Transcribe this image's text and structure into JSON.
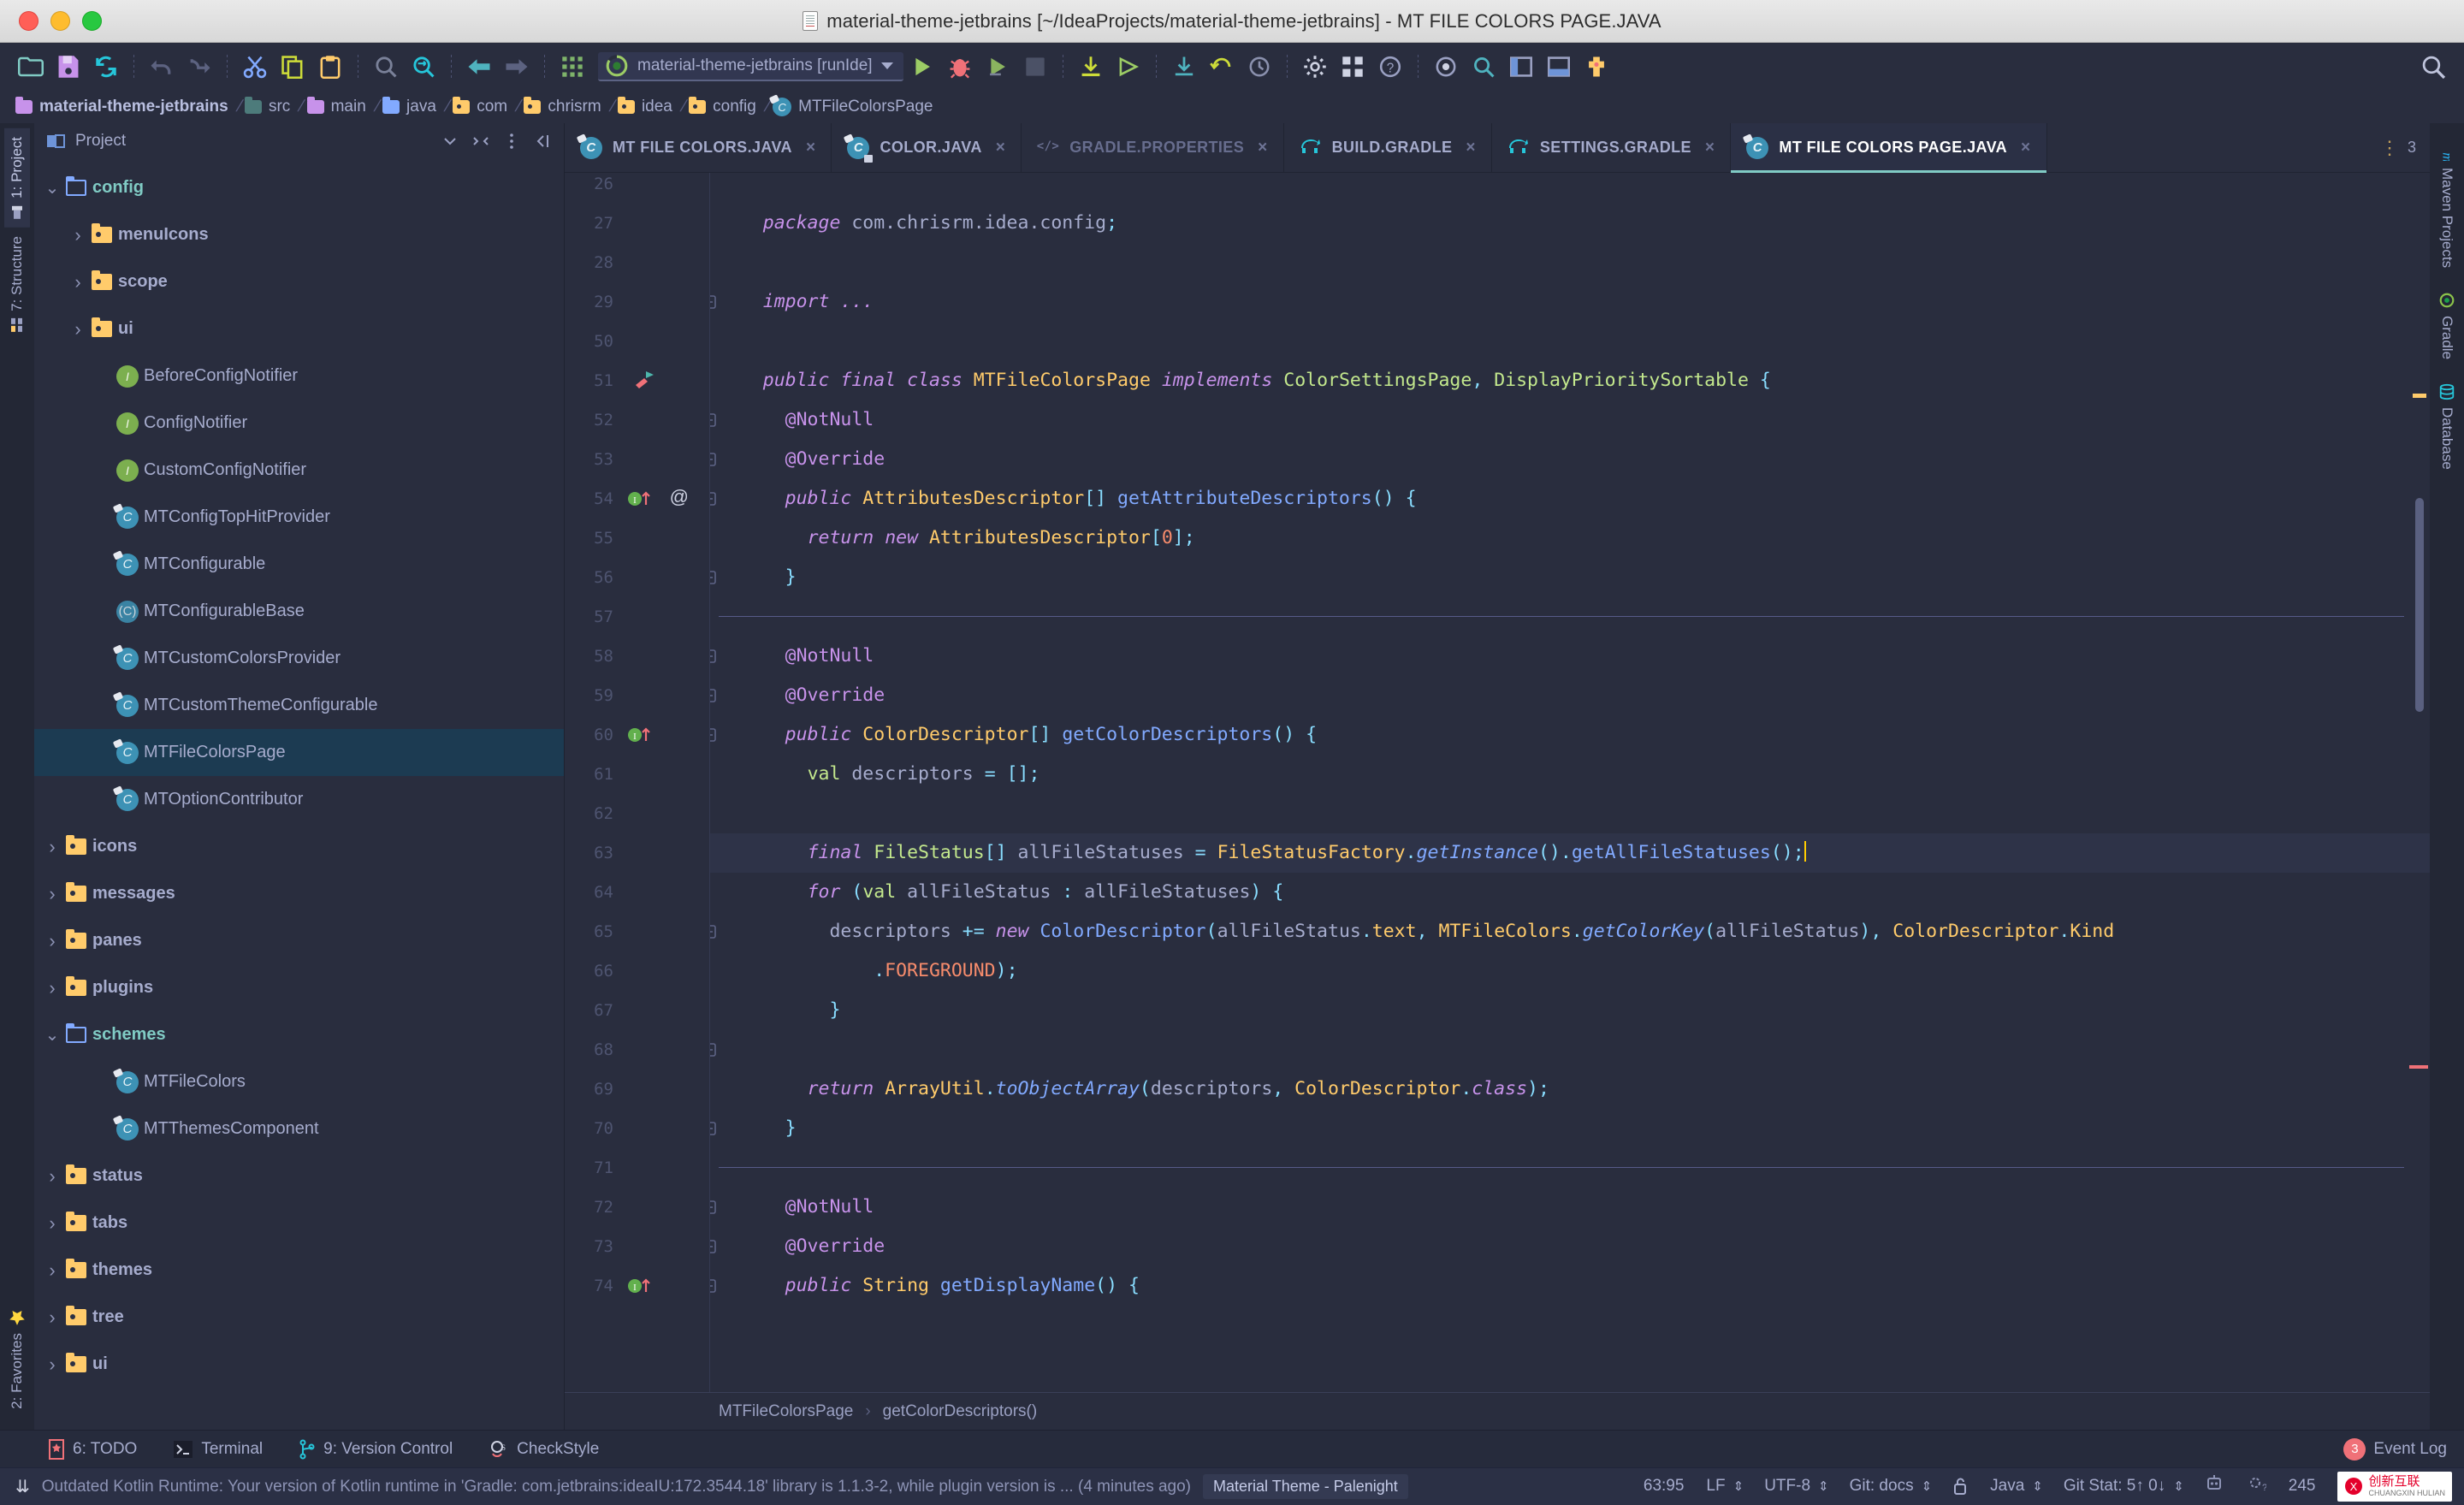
{
  "window": {
    "title": "material-theme-jetbrains [~/IdeaProjects/material-theme-jetbrains] - MT FILE COLORS PAGE.JAVA"
  },
  "toolbar": {
    "icons": [
      "open-folder-icon",
      "save-icon",
      "sync-icon",
      "undo-icon",
      "redo-icon",
      "cut-icon",
      "copy-icon",
      "paste-icon",
      "find-icon",
      "replace-icon",
      "back-icon",
      "forward-icon",
      "grid-icon"
    ],
    "run_config": "material-theme-jetbrains [runIde]",
    "right_icons": [
      "run-icon",
      "debug-icon",
      "run-coverage-icon",
      "stop-icon",
      "build-icon",
      "run-anything-icon",
      "update-icon",
      "rollback-icon",
      "history-icon",
      "settings-icon",
      "modules-icon",
      "help-icon",
      "preferences-icon",
      "search-everywhere-icon",
      "layout-icon",
      "layout2-icon",
      "plugin-icon"
    ],
    "search_icon": "magnifier-icon"
  },
  "breadcrumbs": [
    {
      "label": "material-theme-jetbrains",
      "icon": "module-folder-icon",
      "bold": true
    },
    {
      "label": "src",
      "icon": "source-folder-icon",
      "bold": false
    },
    {
      "label": "main",
      "icon": "module-folder-icon",
      "bold": false
    },
    {
      "label": "java",
      "icon": "java-source-folder-icon",
      "bold": false
    },
    {
      "label": "com",
      "icon": "package-icon",
      "bold": false
    },
    {
      "label": "chrisrm",
      "icon": "package-icon",
      "bold": false
    },
    {
      "label": "idea",
      "icon": "package-icon",
      "bold": false
    },
    {
      "label": "config",
      "icon": "package-icon",
      "bold": false
    },
    {
      "label": "MTFileColorsPage",
      "icon": "class-icon",
      "bold": false
    }
  ],
  "left_rail": [
    {
      "label": "1: Project",
      "icon": "project-icon",
      "active": true
    },
    {
      "label": "7: Structure",
      "icon": "structure-icon",
      "active": false
    },
    {
      "label": "2: Favorites",
      "icon": "star-icon",
      "active": false
    }
  ],
  "right_rail": [
    {
      "label": "Maven Projects",
      "icon": "maven-icon"
    },
    {
      "label": "Gradle",
      "icon": "gradle-icon"
    },
    {
      "label": "Database",
      "icon": "database-icon"
    }
  ],
  "project_panel": {
    "title": "Project",
    "header_icons": [
      "collapse-all-icon",
      "options-menu-icon",
      "hide-panel-icon"
    ],
    "selector_caret": "chevron-down-icon",
    "tree": [
      {
        "label": "config",
        "type": "package-open",
        "depth": 1,
        "twist": "down",
        "selected": false
      },
      {
        "label": "menuIcons",
        "type": "folder",
        "depth": 2,
        "twist": "right",
        "selected": false
      },
      {
        "label": "scope",
        "type": "folder",
        "depth": 2,
        "twist": "right",
        "selected": false
      },
      {
        "label": "ui",
        "type": "folder",
        "depth": 2,
        "twist": "right",
        "selected": false
      },
      {
        "label": "BeforeConfigNotifier",
        "type": "interface",
        "depth": 3,
        "twist": "",
        "selected": false
      },
      {
        "label": "ConfigNotifier",
        "type": "interface",
        "depth": 3,
        "twist": "",
        "selected": false
      },
      {
        "label": "CustomConfigNotifier",
        "type": "interface",
        "depth": 3,
        "twist": "",
        "selected": false
      },
      {
        "label": "MTConfigTopHitProvider",
        "type": "class",
        "depth": 3,
        "twist": "",
        "selected": false
      },
      {
        "label": "MTConfigurable",
        "type": "class",
        "depth": 3,
        "twist": "",
        "selected": false
      },
      {
        "label": "MTConfigurableBase",
        "type": "abstract",
        "depth": 3,
        "twist": "",
        "selected": false
      },
      {
        "label": "MTCustomColorsProvider",
        "type": "class",
        "depth": 3,
        "twist": "",
        "selected": false
      },
      {
        "label": "MTCustomThemeConfigurable",
        "type": "class",
        "depth": 3,
        "twist": "",
        "selected": false
      },
      {
        "label": "MTFileColorsPage",
        "type": "class",
        "depth": 3,
        "twist": "",
        "selected": true
      },
      {
        "label": "MTOptionContributor",
        "type": "class",
        "depth": 3,
        "twist": "",
        "selected": false
      },
      {
        "label": "icons",
        "type": "folder",
        "depth": 1,
        "twist": "right",
        "selected": false
      },
      {
        "label": "messages",
        "type": "folder",
        "depth": 1,
        "twist": "right",
        "selected": false
      },
      {
        "label": "panes",
        "type": "folder",
        "depth": 1,
        "twist": "right",
        "selected": false
      },
      {
        "label": "plugins",
        "type": "folder",
        "depth": 1,
        "twist": "right",
        "selected": false
      },
      {
        "label": "schemes",
        "type": "package-open",
        "depth": 1,
        "twist": "down",
        "selected": false
      },
      {
        "label": "MTFileColors",
        "type": "class",
        "depth": 3,
        "twist": "",
        "selected": false
      },
      {
        "label": "MTThemesComponent",
        "type": "class",
        "depth": 3,
        "twist": "",
        "selected": false
      },
      {
        "label": "status",
        "type": "folder",
        "depth": 1,
        "twist": "right",
        "selected": false
      },
      {
        "label": "tabs",
        "type": "folder",
        "depth": 1,
        "twist": "right",
        "selected": false
      },
      {
        "label": "themes",
        "type": "folder",
        "depth": 1,
        "twist": "right",
        "selected": false
      },
      {
        "label": "tree",
        "type": "folder",
        "depth": 1,
        "twist": "right",
        "selected": false
      },
      {
        "label": "ui",
        "type": "folder",
        "depth": 1,
        "twist": "right",
        "selected": false
      }
    ]
  },
  "editor_tabs": [
    {
      "label": "MT FILE COLORS.JAVA",
      "icon": "java-class-icon",
      "active": false,
      "muted": false,
      "close": "×"
    },
    {
      "label": "COLOR.JAVA",
      "icon": "java-final-icon",
      "active": false,
      "muted": false,
      "close": "×"
    },
    {
      "label": "GRADLE.PROPERTIES",
      "icon": "properties-icon",
      "active": false,
      "muted": true,
      "close": "×"
    },
    {
      "label": "BUILD.GRADLE",
      "icon": "gradle-file-icon",
      "active": false,
      "muted": false,
      "close": "×"
    },
    {
      "label": "SETTINGS.GRADLE",
      "icon": "gradle-file-icon",
      "active": false,
      "muted": false,
      "close": "×"
    },
    {
      "label": "MT FILE COLORS PAGE.JAVA",
      "icon": "java-class-icon",
      "active": true,
      "muted": false,
      "close": "×"
    }
  ],
  "editor_tabs_right": {
    "more_icon": "vertical-dots-icon",
    "count": "3"
  },
  "code": {
    "first_line": 26,
    "lines": [
      {
        "n": 26,
        "html": ""
      },
      {
        "n": 27,
        "html": "    <span class='kw'>package</span> <span class='id'>com.chrisrm.idea.config</span><span class='pun'>;</span>"
      },
      {
        "n": 28,
        "html": ""
      },
      {
        "n": 29,
        "html": "    <span class='kw'>import</span> <span class='kw'>...</span>",
        "fold": "+"
      },
      {
        "n": 30,
        "html": ""
      },
      {
        "n": 31,
        "html": "    <span class='kw'>public</span> <span class='kw'>final</span> <span class='kw'>class</span> <span class='typ'>MTFileColorsPage</span> <span class='kw'>implements</span> <span class='str'>ColorSettingsPage</span><span class='pun'>,</span> <span class='str'>DisplayPrioritySortable</span> <span class='pun'>{</span>",
        "gutter": "run-class-icon"
      },
      {
        "n": 32,
        "html": "      <span class='ann'>@NotNull</span>",
        "fold": "-"
      },
      {
        "n": 33,
        "html": "      <span class='ann'>@Override</span>",
        "fold": "-"
      },
      {
        "n": 34,
        "html": "      <span class='kw'>public</span> <span class='typ'>AttributesDescriptor</span><span class='pun'>[]</span> <span class='fn'>getAttributeDescriptors</span><span class='pun'>()</span> <span class='pun'>{</span>",
        "fold": "-",
        "gutter": "implements-icon",
        "gutter2": "@"
      },
      {
        "n": 35,
        "html": "        <span class='kw'>return</span> <span class='kw'>new</span> <span class='typ'>AttributesDescriptor</span><span class='pun'>[</span><span class='num'>0</span><span class='pun'>];</span>"
      },
      {
        "n": 36,
        "html": "      <span class='pun'>}</span>",
        "fold": "-"
      },
      {
        "n": 37,
        "html": "",
        "separator": true
      },
      {
        "n": 38,
        "html": "      <span class='ann'>@NotNull</span>",
        "fold": "-"
      },
      {
        "n": 39,
        "html": "      <span class='ann'>@Override</span>",
        "fold": "-"
      },
      {
        "n": 40,
        "html": "      <span class='kw'>public</span> <span class='typ'>ColorDescriptor</span><span class='pun'>[]</span> <span class='fn'>getColorDescriptors</span><span class='pun'>()</span> <span class='pun'>{</span>",
        "fold": "-",
        "gutter": "implements-icon"
      },
      {
        "n": 41,
        "html": "        <span class='str'>val</span> <span class='id'>descriptors</span> <span class='pun'>=</span> <span class='pun'>[];</span>"
      },
      {
        "n": 42,
        "html": ""
      },
      {
        "n": 43,
        "html": "        <span class='kw'>final</span> <span class='str'>FileStatus</span><span class='pun'>[]</span> <span class='id'>allFileStatuses</span> <span class='pun'>=</span> <span class='typ'>FileStatusFactory</span><span class='pun'>.</span><span class='fni'>getInstance</span><span class='pun'>().</span><span class='fn'>getAllFileStatuses</span><span class='pun'>();</span><span class='caret'></span>",
        "highlight": true
      },
      {
        "n": 44,
        "html": "        <span class='kw'>for</span> <span class='pun'>(</span><span class='str'>val</span> <span class='id'>allFileStatus</span> <span class='pun'>:</span> <span class='id'>allFileStatuses</span><span class='pun'>)</span> <span class='pun'>{</span>"
      },
      {
        "n": 45,
        "html": "          <span class='id'>descriptors</span> <span class='pun'>+=</span> <span class='kw'>new</span> <span class='fn'>ColorDescriptor</span><span class='pun'>(</span><span class='id'>allFileStatus</span><span class='pun'>.</span><span class='fld'>text</span><span class='pun'>,</span> <span class='typ'>MTFileColors</span><span class='pun'>.</span><span class='fni'>getColorKey</span><span class='pun'>(</span><span class='id'>allFileStatus</span><span class='pun'>),</span> <span class='typ'>ColorDescriptor</span><span class='pun'>.</span><span class='typ'>Kind</span>",
        "fold": "+"
      },
      {
        "n": 46,
        "html": "              <span class='pun'>.</span><span class='num'>FOREGROUND</span><span class='pun'>);</span>"
      },
      {
        "n": 47,
        "html": "          <span class='pun'>}</span>"
      },
      {
        "n": 48,
        "html": "",
        "fold": "-"
      },
      {
        "n": 49,
        "html": "        <span class='kw'>return</span> <span class='typ'>ArrayUtil</span><span class='pun'>.</span><span class='fni'>toObjectArray</span><span class='pun'>(</span><span class='id'>descriptors</span><span class='pun'>,</span> <span class='typ'>ColorDescriptor</span><span class='pun'>.</span><span class='kw'>class</span><span class='pun'>);</span>"
      },
      {
        "n": 50,
        "html": "      <span class='pun'>}</span>",
        "fold": "-"
      },
      {
        "n": 51,
        "html": "",
        "separator": true
      },
      {
        "n": 52,
        "html": "      <span class='ann'>@NotNull</span>",
        "fold": "-"
      },
      {
        "n": 53,
        "html": "      <span class='ann'>@Override</span>",
        "fold": "-"
      },
      {
        "n": 54,
        "html": "      <span class='kw'>public</span> <span class='typ'>String</span> <span class='fn'>getDisplayName</span><span class='pun'>()</span> <span class='pun'>{</span>",
        "fold": "-",
        "gutter": "implements-icon"
      }
    ],
    "line_numbers": [
      26,
      27,
      28,
      29,
      30,
      31,
      32,
      33,
      34,
      35,
      36,
      37,
      38,
      39,
      40,
      41,
      42,
      43,
      44,
      45,
      46,
      47,
      48,
      49,
      50,
      51,
      52,
      53,
      54
    ],
    "displayed_numbers": [
      "26",
      "27",
      "28",
      "29",
      "50",
      "51",
      "52",
      "53",
      "54",
      "55",
      "56",
      "57",
      "58",
      "59",
      "60",
      "61",
      "62",
      "63",
      "64",
      "65",
      "66",
      "67",
      "68",
      "69",
      "70",
      "71",
      "72",
      "73",
      "74"
    ]
  },
  "editor_breadcrumb": [
    "MTFileColorsPage",
    "getColorDescriptors()"
  ],
  "tool_window_bar": [
    {
      "label": "6: TODO",
      "icon": "todo-icon"
    },
    {
      "label": "Terminal",
      "icon": "terminal-icon"
    },
    {
      "label": "9: Version Control",
      "icon": "vcs-icon"
    },
    {
      "label": "CheckStyle",
      "icon": "checkstyle-icon"
    }
  ],
  "tool_window_bar_right": {
    "event_log": "Event Log",
    "event_count": "3",
    "event_icon": "event-log-icon"
  },
  "status_bar": {
    "message": "Outdated Kotlin Runtime: Your version of Kotlin runtime in 'Gradle: com.jetbrains:ideaIU:172.3544.18' library is 1.1.3-2, while plugin version is ... (4 minutes ago)",
    "message_icon": "chevrons-down-icon",
    "theme": "Material Theme - Palenight",
    "caret_position": "63:95",
    "line_separator": "LF",
    "encoding": "UTF-8",
    "git_branch": "Git: docs",
    "lock_icon": "unlocked-icon",
    "language": "Java",
    "git_stat": "Git Stat: 5↑ 0↓",
    "memory": "245",
    "right_icons": [
      "inspector-icon",
      "background-tasks-icon"
    ],
    "watermark": "创新互联",
    "watermark_sub": "CHUANGXIN HULIAN"
  },
  "colors": {
    "accent": "#80cbc4",
    "background": "#292d3e",
    "selection": "#1c3b52",
    "keyword": "#c792ea",
    "type": "#ffcb6b",
    "function": "#82aaff",
    "string": "#c3e88d",
    "number": "#f78c6c",
    "text": "#a6accd"
  }
}
